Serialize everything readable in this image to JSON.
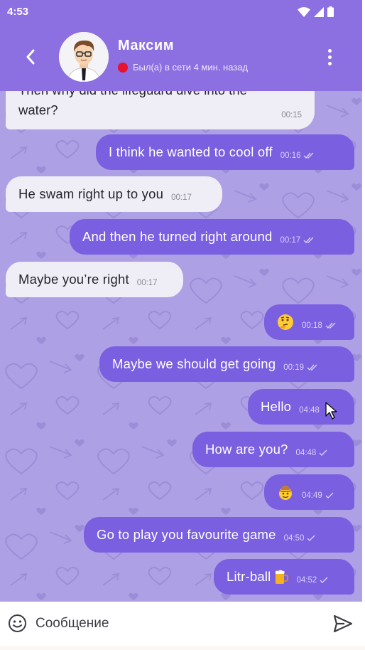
{
  "status_bar": {
    "time": "4:53"
  },
  "header": {
    "contact_name": "Максим",
    "status_text": "Был(а) в сети 4 мин. назад",
    "status_color": "#e8112e",
    "accent_color": "#8c6fe0"
  },
  "messages": [
    {
      "direction": "in",
      "text": "Then why did the lifeguard dive into the water?",
      "time": "00:15"
    },
    {
      "direction": "out",
      "text": "I think he wanted to cool off",
      "time": "00:16",
      "status": "read"
    },
    {
      "direction": "in",
      "text": "He swam right up to you",
      "time": "00:17"
    },
    {
      "direction": "out",
      "text": "And then he turned right around",
      "time": "00:17",
      "status": "read"
    },
    {
      "direction": "in",
      "text": "Maybe you’re right",
      "time": "00:17"
    },
    {
      "direction": "out",
      "text": "",
      "emoji": "thinking-face-icon",
      "time": "00:18",
      "status": "read"
    },
    {
      "direction": "out",
      "text": "Maybe we should get going",
      "time": "00:19",
      "status": "read"
    },
    {
      "direction": "out",
      "text": "Hello",
      "time": "04:48",
      "status": "sent"
    },
    {
      "direction": "out",
      "text": "How are you?",
      "time": "04:48",
      "status": "sent"
    },
    {
      "direction": "out",
      "text": "",
      "emoji": "cowboy-face-icon",
      "time": "04:49",
      "status": "sent"
    },
    {
      "direction": "out",
      "text": "Go to play you favourite game",
      "time": "04:50",
      "status": "sent"
    },
    {
      "direction": "out",
      "text": "Litr-ball",
      "emoji": "beer-mug-icon",
      "time": "04:52",
      "status": "sent"
    }
  ],
  "composer": {
    "placeholder": "Сообщение"
  },
  "icons": {
    "back": "back-arrow-icon",
    "menu": "more-vertical-icon",
    "smile": "smile-icon",
    "send": "send-icon"
  },
  "colors": {
    "outgoing_bubble": "#7a5fe0",
    "incoming_bubble": "#efedf6",
    "chat_background": "#aea0e4"
  }
}
